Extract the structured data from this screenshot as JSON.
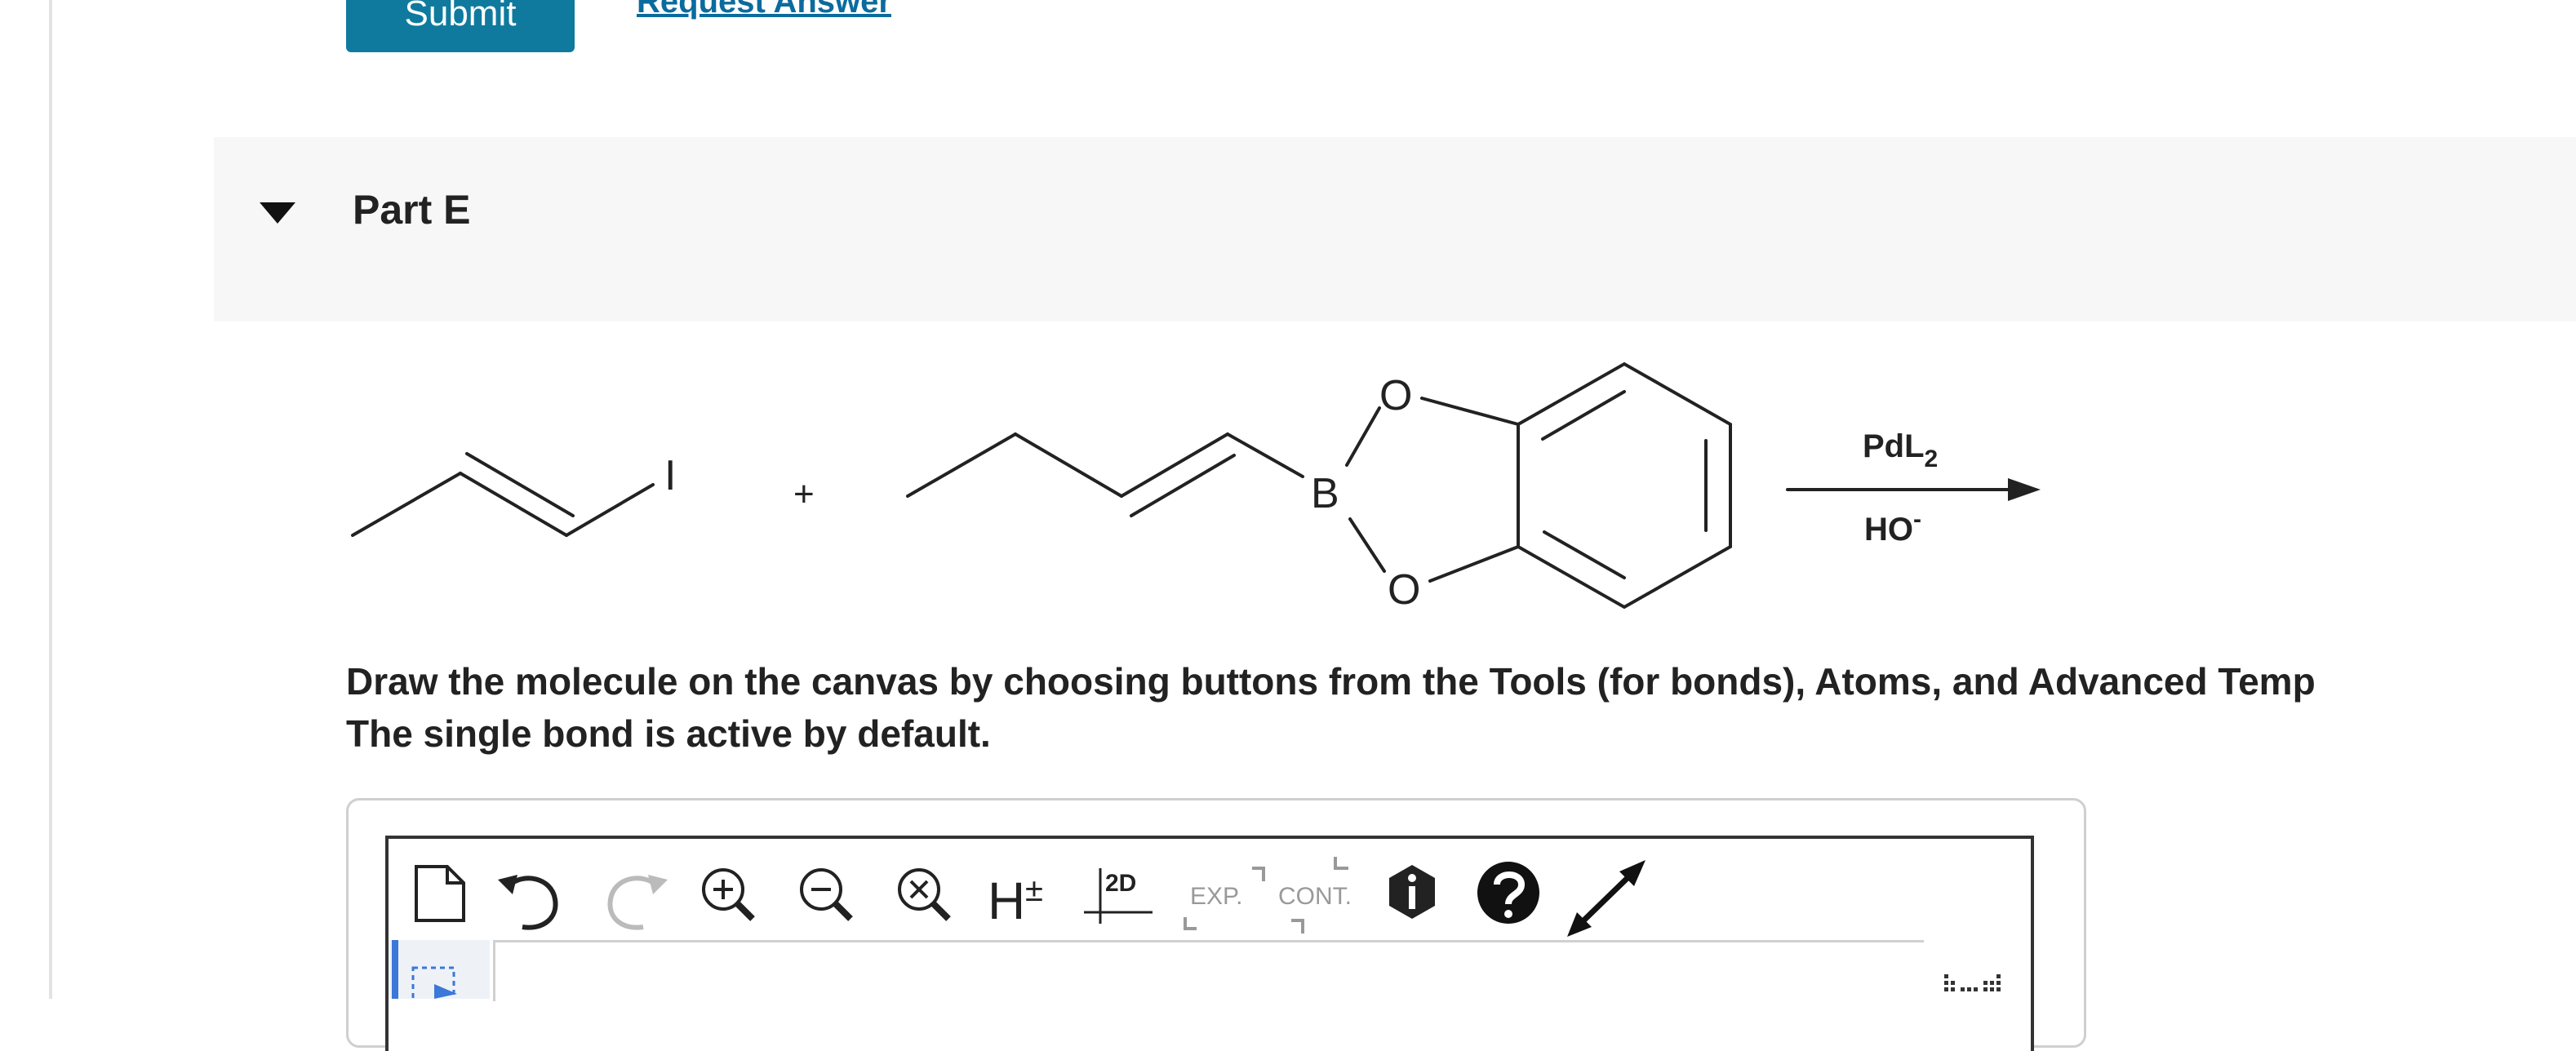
{
  "actions": {
    "submit_label": "Submit",
    "request_answer_label": "Request Answer"
  },
  "part": {
    "title": "Part E"
  },
  "reaction": {
    "reactant1_atom": "I",
    "plus": "+",
    "boron": "B",
    "oxygen": "O",
    "reagent_above": "PdL",
    "reagent_above_sub": "2",
    "reagent_below": "HO",
    "reagent_below_sup": "-"
  },
  "instructions": {
    "line1": "Draw the molecule on the canvas by choosing buttons from the Tools (for bonds), Atoms, and Advanced Temp",
    "line2": "The single bond is active by default."
  },
  "toolbar": {
    "tools": [
      {
        "name": "new-document-icon"
      },
      {
        "name": "undo-icon"
      },
      {
        "name": "redo-icon"
      },
      {
        "name": "zoom-in-icon"
      },
      {
        "name": "zoom-out-icon"
      },
      {
        "name": "zoom-reset-icon"
      },
      {
        "name": "hydrogen-toggle-icon"
      },
      {
        "name": "clean-2d-icon"
      },
      {
        "name": "expand-group-icon"
      },
      {
        "name": "contract-group-icon"
      },
      {
        "name": "info-icon"
      },
      {
        "name": "help-icon"
      },
      {
        "name": "fullscreen-icon"
      }
    ],
    "h_label": "H",
    "h_sub": "±",
    "clean_label": "2D",
    "exp_label": "EXP.",
    "cont_label": "CONT."
  },
  "colors": {
    "accent": "#0f7a9e",
    "link": "#0c6b9d",
    "active_tool": "#3b78d8"
  }
}
